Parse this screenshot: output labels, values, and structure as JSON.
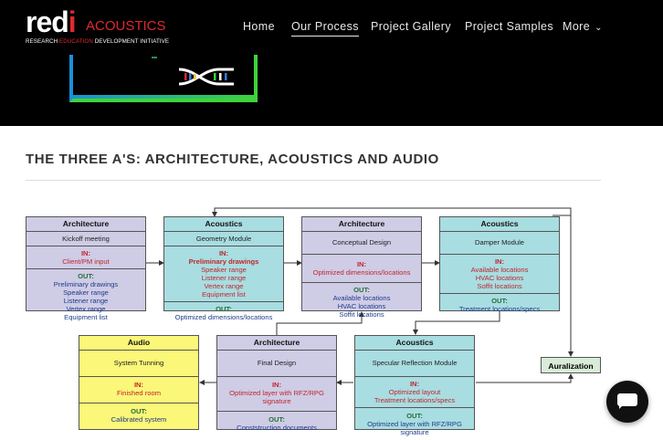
{
  "logo": {
    "word_a": "r",
    "word_b": "e",
    "word_c": "d",
    "word_d": "i",
    "suffix": "ACOUSTICS",
    "tag_a": "RESEARCH ",
    "tag_b": "EDUCATION",
    "tag_c": " DEVELOPMENT INITIATIVE"
  },
  "nav": {
    "items": [
      {
        "label": "Home"
      },
      {
        "label": "Our Process"
      },
      {
        "label": "Project Gallery"
      },
      {
        "label": "Project Samples"
      },
      {
        "label": "More"
      }
    ],
    "active": "Our Process"
  },
  "section_title": "THE THREE A'S: ARCHITECTURE, ACOUSTICS AND AUDIO",
  "diagram": {
    "b1": {
      "title": "Architecture",
      "sub": "Kickoff meeting",
      "in_label": "IN:",
      "in": [
        "Client/PM input"
      ],
      "out_label": "OUT:",
      "out": [
        "Preliminary drawings",
        "Speaker range",
        "Listener range",
        "Vertex range",
        "Equipment list"
      ]
    },
    "b2": {
      "title": "Acoustics",
      "sub": "Geometry Module",
      "in_label": "IN:",
      "in_bold": "Preliminary drawings",
      "in": [
        "Speaker range",
        "Listener range",
        "Vertex range",
        "Equipment list"
      ],
      "out_label": "OUT:",
      "out": [
        "Optimized dimensions/locations"
      ]
    },
    "b3": {
      "title": "Architecture",
      "sub": "Conceptual Design",
      "in_label": "IN:",
      "in": [
        "Optimized dimensions/locations"
      ],
      "out_label": "OUT:",
      "out": [
        "Available locations",
        "HVAC locations",
        "Soffit locations"
      ]
    },
    "b4": {
      "title": "Acoustics",
      "sub": "Damper Module",
      "in_label": "IN:",
      "in": [
        "Available locations",
        "HVAC locations",
        "Soffit locations"
      ],
      "out_label": "OUT:",
      "out": [
        "Treatment locations/specs"
      ]
    },
    "b5": {
      "title": "Acoustics",
      "sub": "Specular Reflection Module",
      "in_label": "IN:",
      "in": [
        "Optimized layout",
        "Treatment locations/specs"
      ],
      "out_label": "OUT:",
      "out": [
        "Optimized layer with RFZ/RPG signature"
      ]
    },
    "b6": {
      "title": "Architecture",
      "sub": "Final Design",
      "in_label": "IN:",
      "in": [
        "Optimized layer with RFZ/RPG signature"
      ],
      "out_label": "OUT:",
      "out": [
        "Conststruction documents"
      ]
    },
    "b7": {
      "title": "Audio",
      "sub": "System Tunning",
      "in_label": "IN:",
      "in": [
        "Finished room"
      ],
      "out_label": "OUT:",
      "out": [
        "Calibrated system"
      ]
    },
    "auralization": "Auralization"
  },
  "colors": {
    "header_bg": "#000000",
    "brand_red": "#e0282f",
    "architecture_box": "#cfcce6",
    "acoustics_box": "#a8dde1",
    "audio_box": "#fbf778",
    "auralization_box": "#d8ecd8",
    "in_text": "#c0262c",
    "out_text": "#266d3c"
  },
  "chat": {
    "icon": "chat-bubble-icon"
  }
}
